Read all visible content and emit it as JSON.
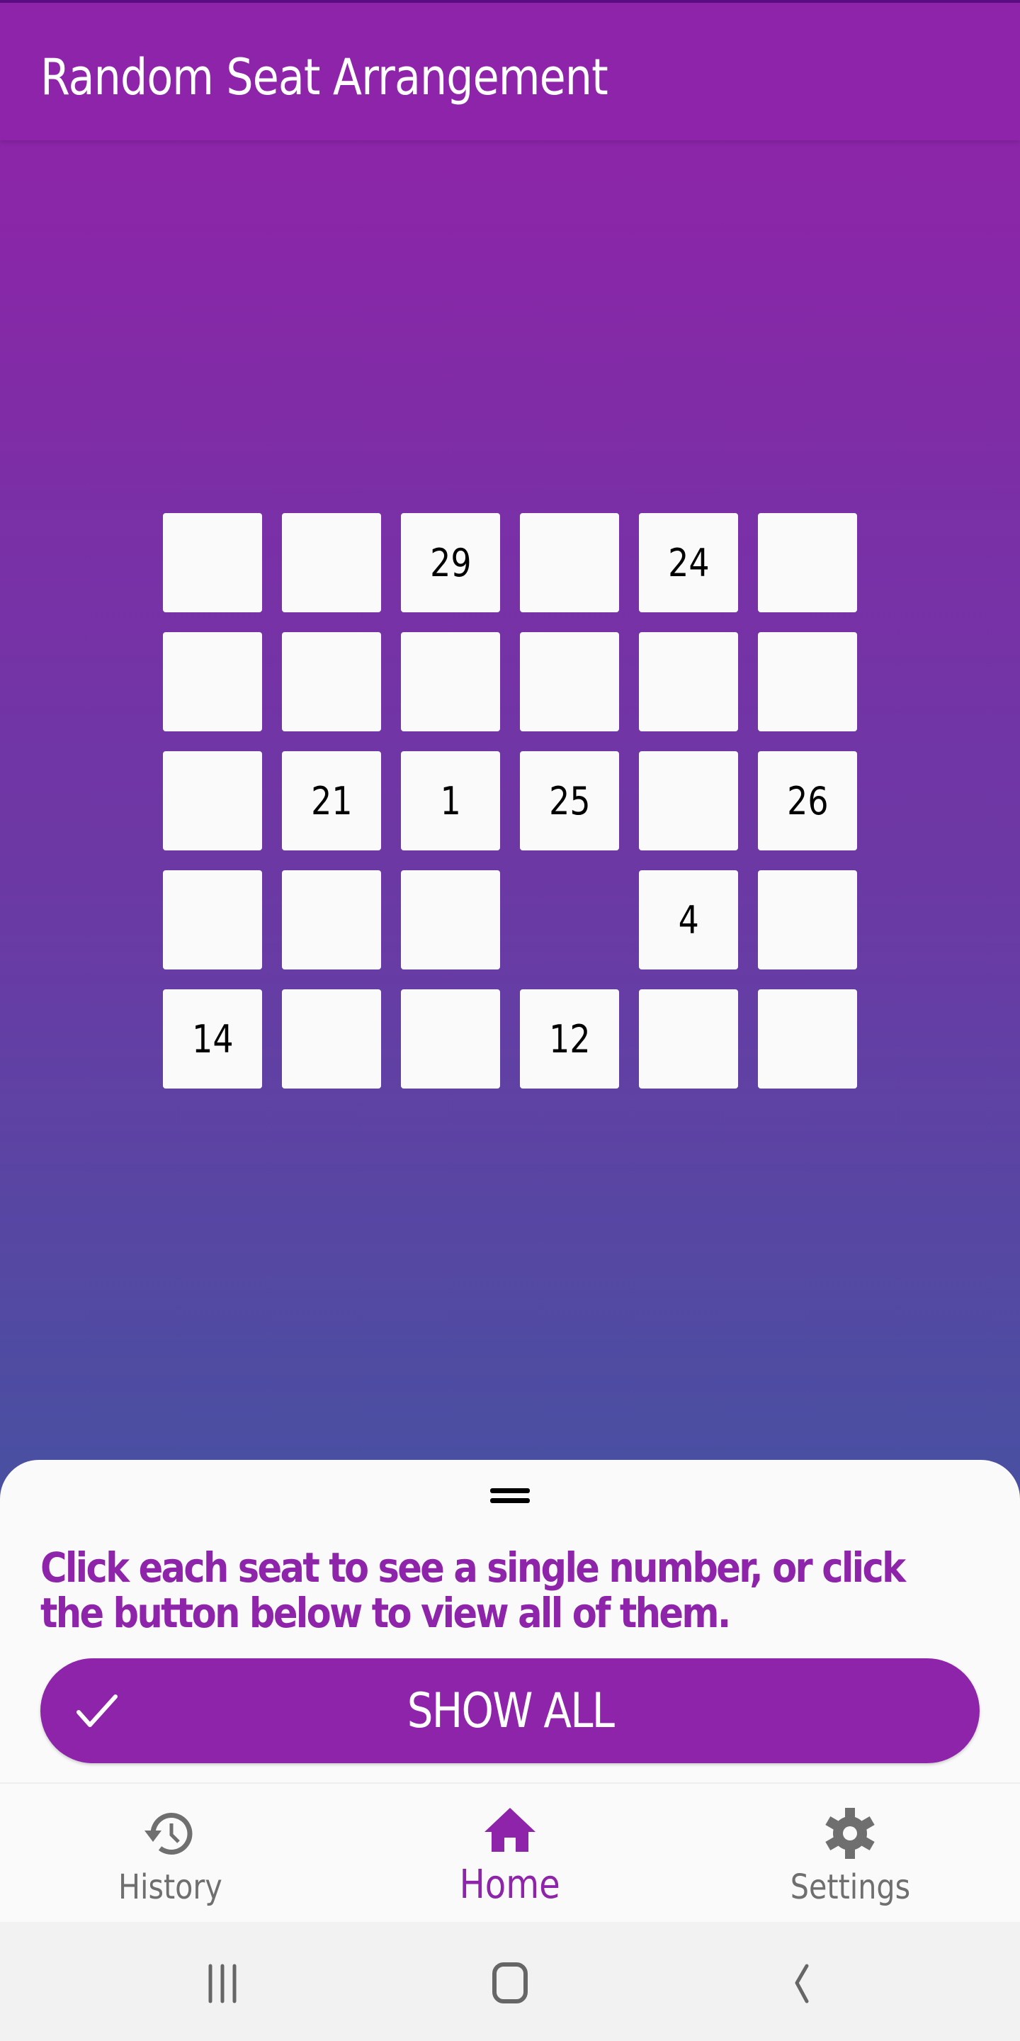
{
  "app_bar": {
    "title": "Random Seat Arrangement"
  },
  "seats": {
    "rows": 5,
    "columns": 6,
    "grid": [
      [
        {
          "label": ""
        },
        {
          "label": ""
        },
        {
          "label": "29"
        },
        {
          "label": ""
        },
        {
          "label": "24"
        },
        {
          "label": ""
        }
      ],
      [
        {
          "label": ""
        },
        {
          "label": ""
        },
        {
          "label": ""
        },
        {
          "label": ""
        },
        {
          "label": ""
        },
        {
          "label": ""
        }
      ],
      [
        {
          "label": ""
        },
        {
          "label": "21"
        },
        {
          "label": "1"
        },
        {
          "label": "25"
        },
        {
          "label": ""
        },
        {
          "label": "26"
        }
      ],
      [
        {
          "label": ""
        },
        {
          "label": ""
        },
        {
          "label": ""
        },
        {
          "label": null,
          "empty_slot": true
        },
        {
          "label": "4"
        },
        {
          "label": ""
        }
      ],
      [
        {
          "label": "14"
        },
        {
          "label": ""
        },
        {
          "label": ""
        },
        {
          "label": "12"
        },
        {
          "label": ""
        },
        {
          "label": ""
        }
      ]
    ]
  },
  "bottom_sheet": {
    "handle_icon": "drag-handle-icon",
    "instructions": "Click each seat to see a single number, or click the button below to view all of them.",
    "show_all_button": {
      "label": "SHOW ALL",
      "icon": "check-icon"
    }
  },
  "bottom_nav": {
    "items": [
      {
        "label": "History",
        "icon": "history-icon",
        "active": false
      },
      {
        "label": "Home",
        "icon": "home-icon",
        "active": true
      },
      {
        "label": "Settings",
        "icon": "settings-gear-icon",
        "active": false
      }
    ]
  },
  "system_nav": {
    "buttons": [
      "recent-apps-icon",
      "home-circle-icon",
      "back-icon"
    ]
  },
  "colors": {
    "primary": "#8e24aa",
    "gradient_top": "#8e24aa",
    "gradient_bottom": "#4a4fa2",
    "seat_background": "#fafafa",
    "inactive_nav": "#6f6f6f"
  }
}
